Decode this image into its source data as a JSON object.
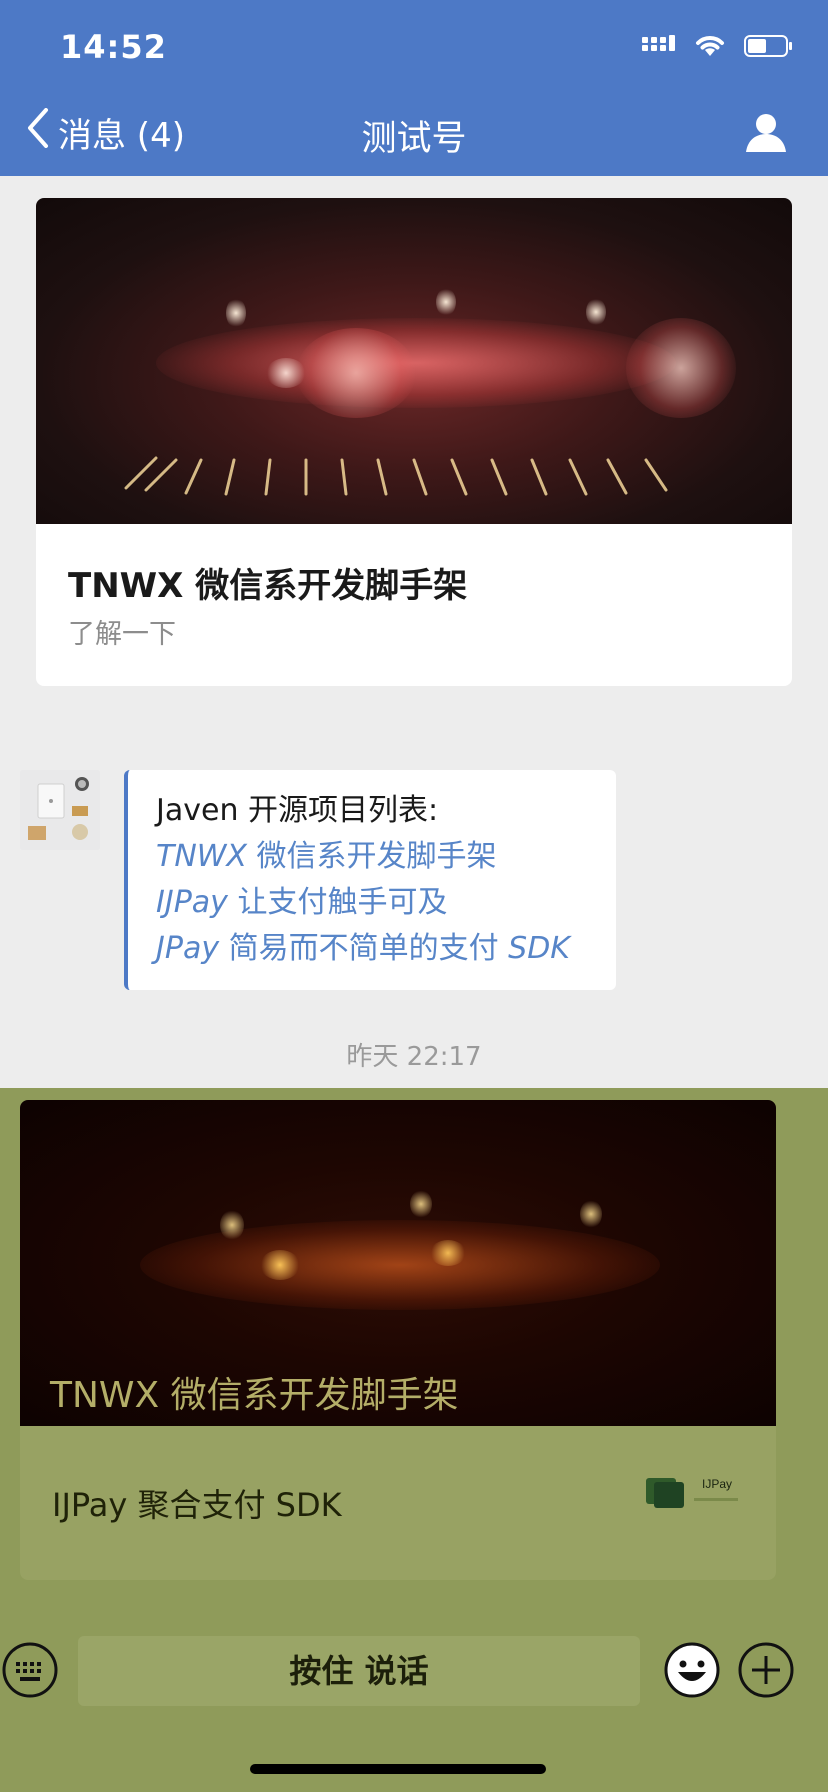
{
  "status_bar": {
    "time": "14:52"
  },
  "nav": {
    "back_label": "消息 (4)",
    "title": "测试号"
  },
  "top_card": {
    "title": "TNWX 微信系开发脚手架",
    "subtitle": "了解一下"
  },
  "message": {
    "intro": "Javen 开源项目列表:",
    "links": [
      {
        "name": "TNWX",
        "desc": " 微信系开发脚手架"
      },
      {
        "name": "IJPay",
        "desc": " 让支付触手可及"
      },
      {
        "name": "JPay",
        "desc": " 简易而不简单的支付 ",
        "suffix": "SDK"
      }
    ]
  },
  "timestamp": "昨天 22:17",
  "bottom_card": {
    "cover_title": "TNWX 微信系开发脚手架",
    "item_title": "IJPay 聚合支付 SDK",
    "logo_text": "IJPay"
  },
  "input_bar": {
    "hold_to_talk": "按住 说话"
  },
  "colors": {
    "header": "#4d79c6",
    "link": "#5785c8",
    "overlay": "#8f9b5a"
  }
}
